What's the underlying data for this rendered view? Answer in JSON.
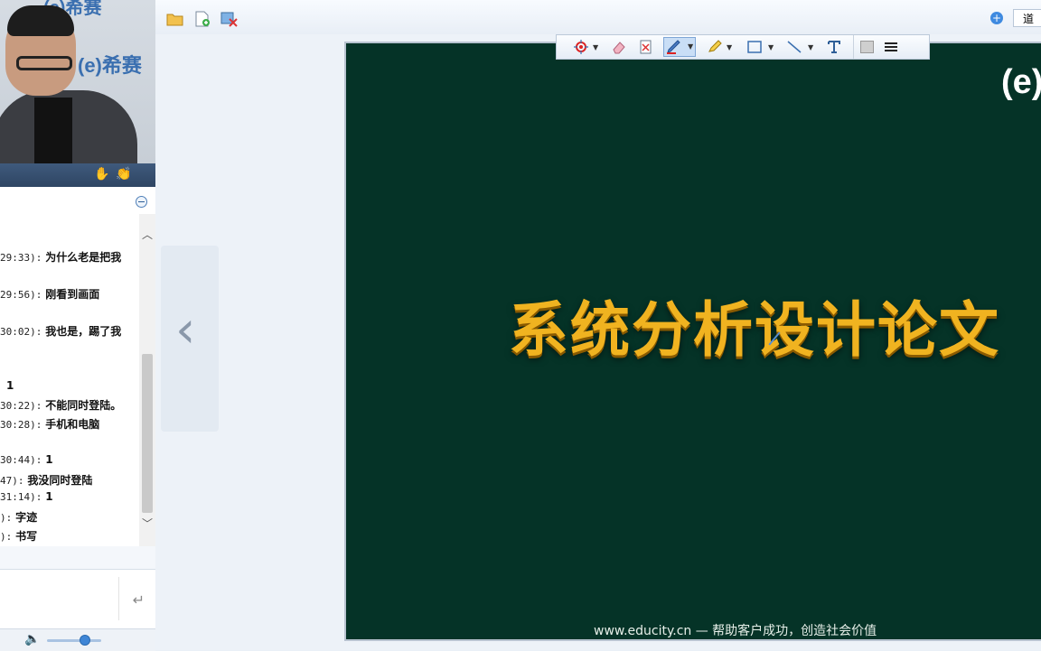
{
  "video": {
    "brand_top": "(e)希赛",
    "brand_mid": "(e)希赛"
  },
  "chat": {
    "messages": [
      {
        "time": "29:33):",
        "text": "为什么老是把我"
      },
      {
        "time": "29:56):",
        "text": "刚看到画面"
      },
      {
        "time": "30:02):",
        "text": "我也是，踢了我"
      },
      {
        "time": "",
        "text": "1"
      },
      {
        "time": "30:22):",
        "text": "不能同时登陆。"
      },
      {
        "time": "30:28):",
        "text": "手机和电脑"
      },
      {
        "time": "30:44):",
        "text": "1"
      },
      {
        "time": "47):",
        "text": "我没同时登陆"
      },
      {
        "time": "31:14):",
        "text": "1"
      },
      {
        "time": "):",
        "text": "字迹"
      },
      {
        "time": "):",
        "text": "书写"
      }
    ],
    "volume": 0.7
  },
  "top_toolbar": {
    "input_value": "道"
  },
  "slide": {
    "title": "系统分析设计论文",
    "logo": "(e)",
    "footer": "www.educity.cn — 帮助客户成功，创造社会价值"
  },
  "colors": {
    "slide_bg": "#053327",
    "title": "#f0b320",
    "chat_header": "#3f5a7d"
  }
}
